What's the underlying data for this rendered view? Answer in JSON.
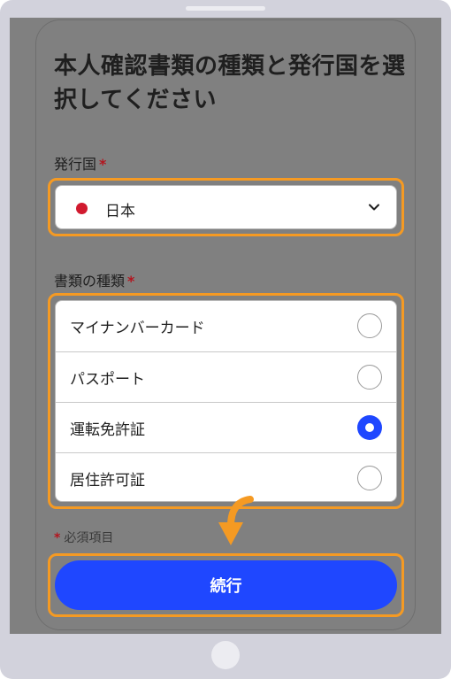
{
  "page": {
    "title": "本人確認書類の種類と発行国を選択してください"
  },
  "issuing_country": {
    "label": "発行国",
    "required_mark": "*",
    "selected": "日本",
    "flag_color": "#d11a2f"
  },
  "document_type": {
    "label": "書類の種類",
    "required_mark": "*",
    "options": [
      {
        "label": "マイナンバーカード",
        "selected": false
      },
      {
        "label": "パスポート",
        "selected": false
      },
      {
        "label": "運転免許証",
        "selected": true
      },
      {
        "label": "居住許可証",
        "selected": false
      }
    ]
  },
  "required_note": {
    "mark": "*",
    "text": "必須項目"
  },
  "continue_button": {
    "label": "続行"
  },
  "colors": {
    "accent": "#1f47ff",
    "highlight": "#f59a23",
    "required": "#b3151f",
    "overlay": "#808080"
  }
}
